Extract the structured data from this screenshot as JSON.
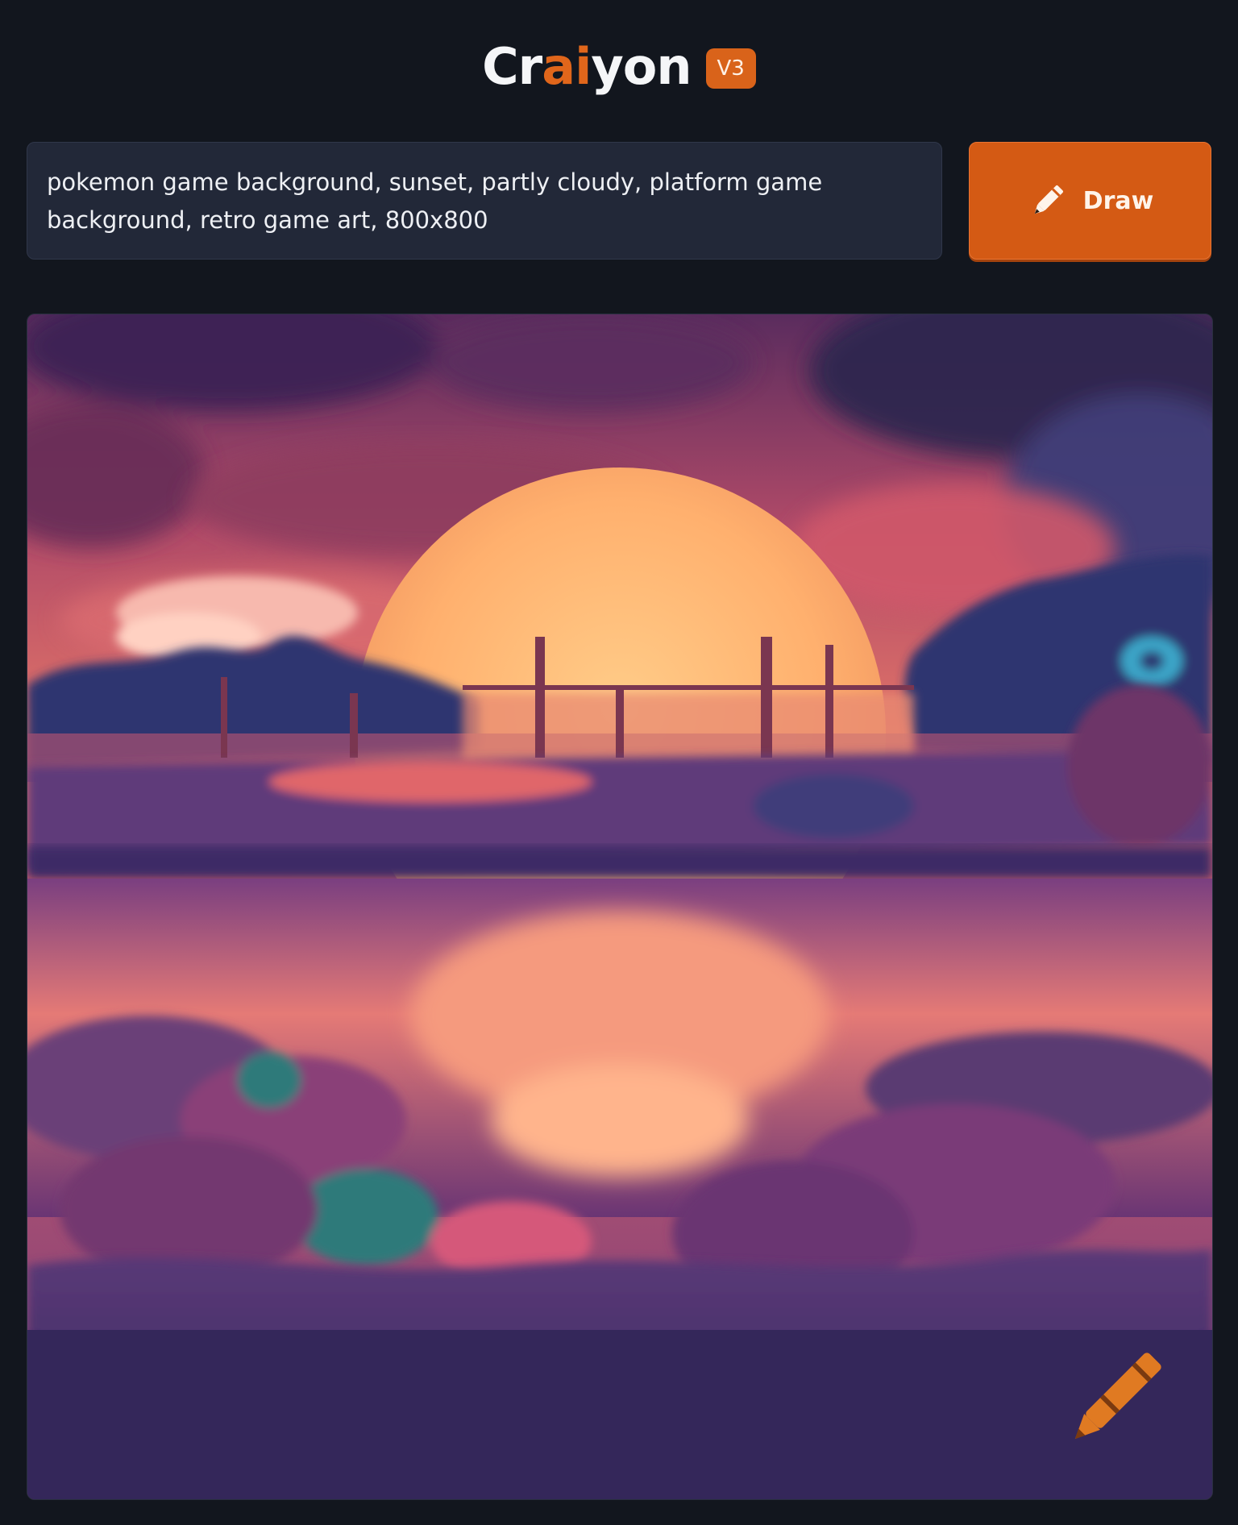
{
  "header": {
    "logo_part_1": "Cr",
    "logo_part_2": "ai",
    "logo_part_3": "yon",
    "version": "V3"
  },
  "prompt": {
    "text": "pokemon game background, sunset, partly cloudy, platform game background, retro game art, 800x800"
  },
  "draw_button": {
    "label": "Draw",
    "icon": "pencil-icon"
  },
  "result": {
    "watermark_icon": "crayon-icon"
  },
  "colors": {
    "background": "#12161e",
    "accent": "#e0661b",
    "button": "#d45a14",
    "input_bg": "#222838"
  }
}
